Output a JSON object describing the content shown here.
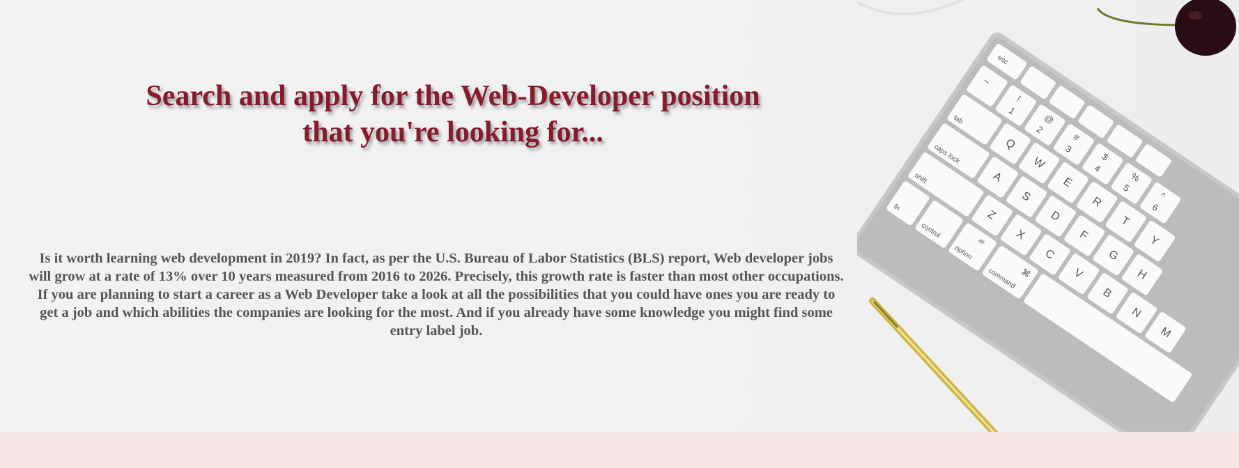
{
  "hero": {
    "headline": "Search and apply for the Web-Developer position that you're looking for...",
    "intro": "Is it worth learning web development in 2019? In fact, as per the U.S. Bureau of Labor Statistics (BLS) report, Web developer jobs will grow at a rate of 13% over 10 years measured from 2016 to 2026. Precisely, this growth rate is faster than most other occupations. If you are planning to start a career as a Web Developer take a look at all the possibilities that you could have ones you are ready to get a job and which abilities the companies are looking for the most. And if you already have some knowledge you might find some entry label job."
  },
  "photo": {
    "keys": {
      "esc": "esc",
      "tab": "tab",
      "caps": "caps lock",
      "shift": "shift",
      "fn": "fn",
      "control": "control",
      "option": "option",
      "alt": "alt",
      "command": "command",
      "cmd_symbol": "⌘",
      "q": "Q",
      "w": "W",
      "e": "E",
      "r": "R",
      "t": "T",
      "y": "Y",
      "a": "A",
      "s": "S",
      "d": "D",
      "f": "F",
      "g": "G",
      "h": "H",
      "z": "Z",
      "x": "X",
      "c": "C",
      "v": "V",
      "b": "B",
      "n": "N",
      "m": "M",
      "n1": "1",
      "n2": "2",
      "n3": "3",
      "n4": "4",
      "n5": "5",
      "n6": "6",
      "s1": "!",
      "s2": "@",
      "s3": "#",
      "s4": "$",
      "s5": "%",
      "s6": "^",
      "tilde": "~"
    }
  },
  "colors": {
    "headline": "#861b2b",
    "body_text": "#555555",
    "page_background": "#f6e6e8",
    "hero_background": "#f1f1f1"
  }
}
